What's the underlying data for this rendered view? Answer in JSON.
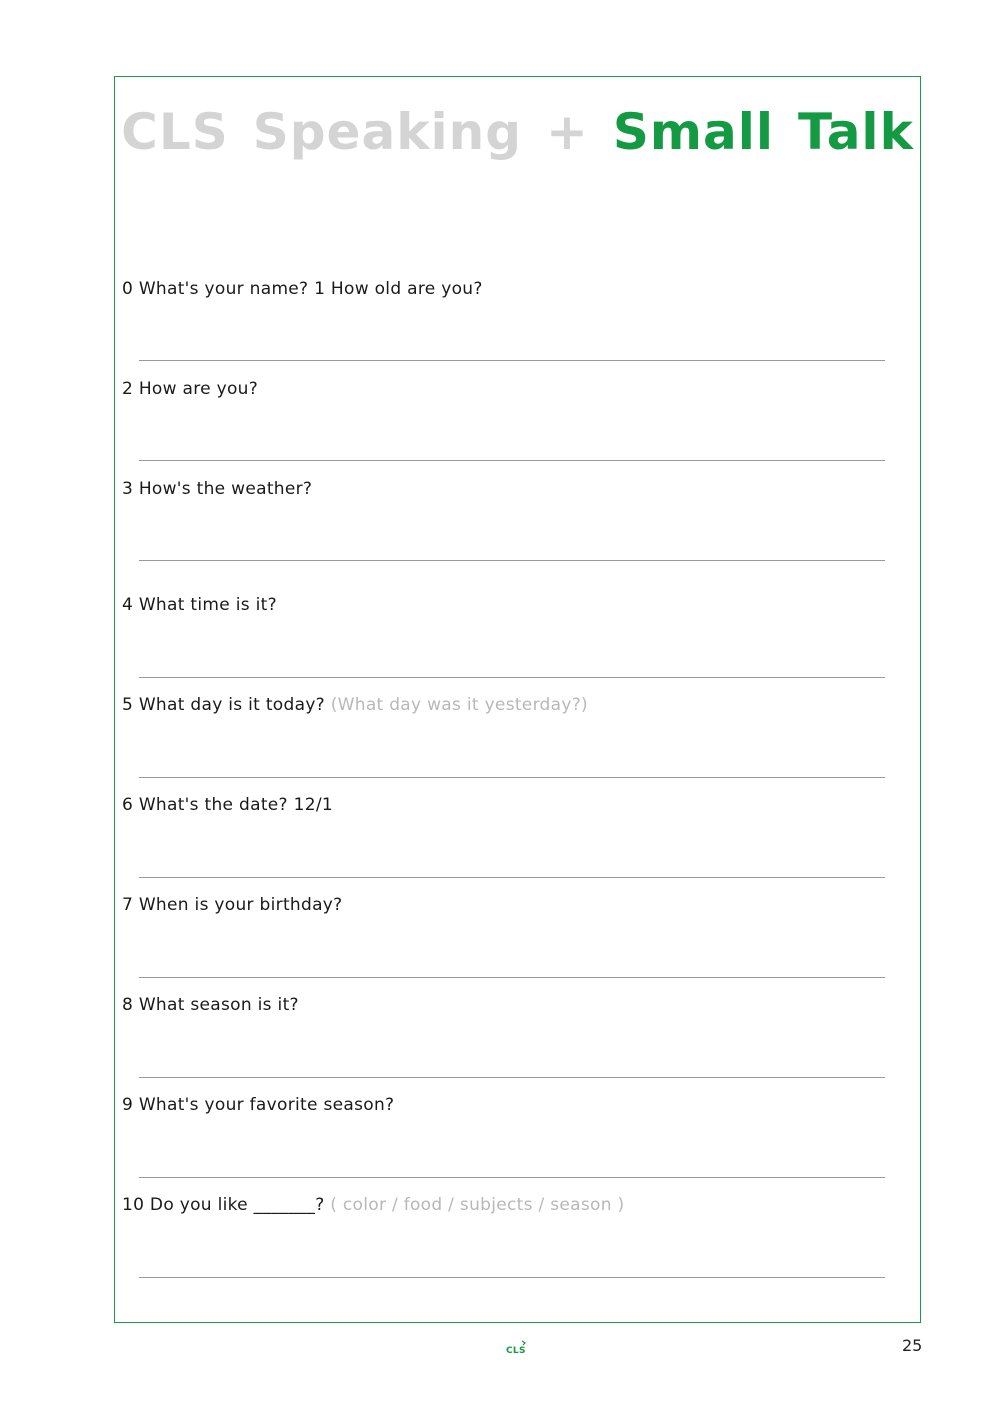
{
  "title": {
    "part1": "CLS",
    "part2": "Speaking",
    "plus": "+",
    "part3": "Small",
    "part4": "Talk"
  },
  "questions": [
    {
      "text": "0 What's your name? 1 How old are you?",
      "hint": ""
    },
    {
      "text": "2 How are you?",
      "hint": ""
    },
    {
      "text": "3 How's the weather?",
      "hint": ""
    },
    {
      "text": "4 What time is it?",
      "hint": ""
    },
    {
      "text": "5 What day is it today?",
      "hint": "(What day was it yesterday?)"
    },
    {
      "text": "6 What's the date? 12/1",
      "hint": ""
    },
    {
      "text": "7 When is your birthday?",
      "hint": ""
    },
    {
      "text": "8 What season is it?",
      "hint": ""
    },
    {
      "text": "9 What's your favorite season?",
      "hint": ""
    },
    {
      "text": "10 Do you like _______?",
      "hint": "( color / food / subjects / season )"
    }
  ],
  "footer": {
    "logo_text": "CLS",
    "page_number": "25"
  },
  "colors": {
    "accent": "#149a42",
    "title_grey": "#d4d4d4",
    "hint_grey": "#b8b8b8"
  }
}
